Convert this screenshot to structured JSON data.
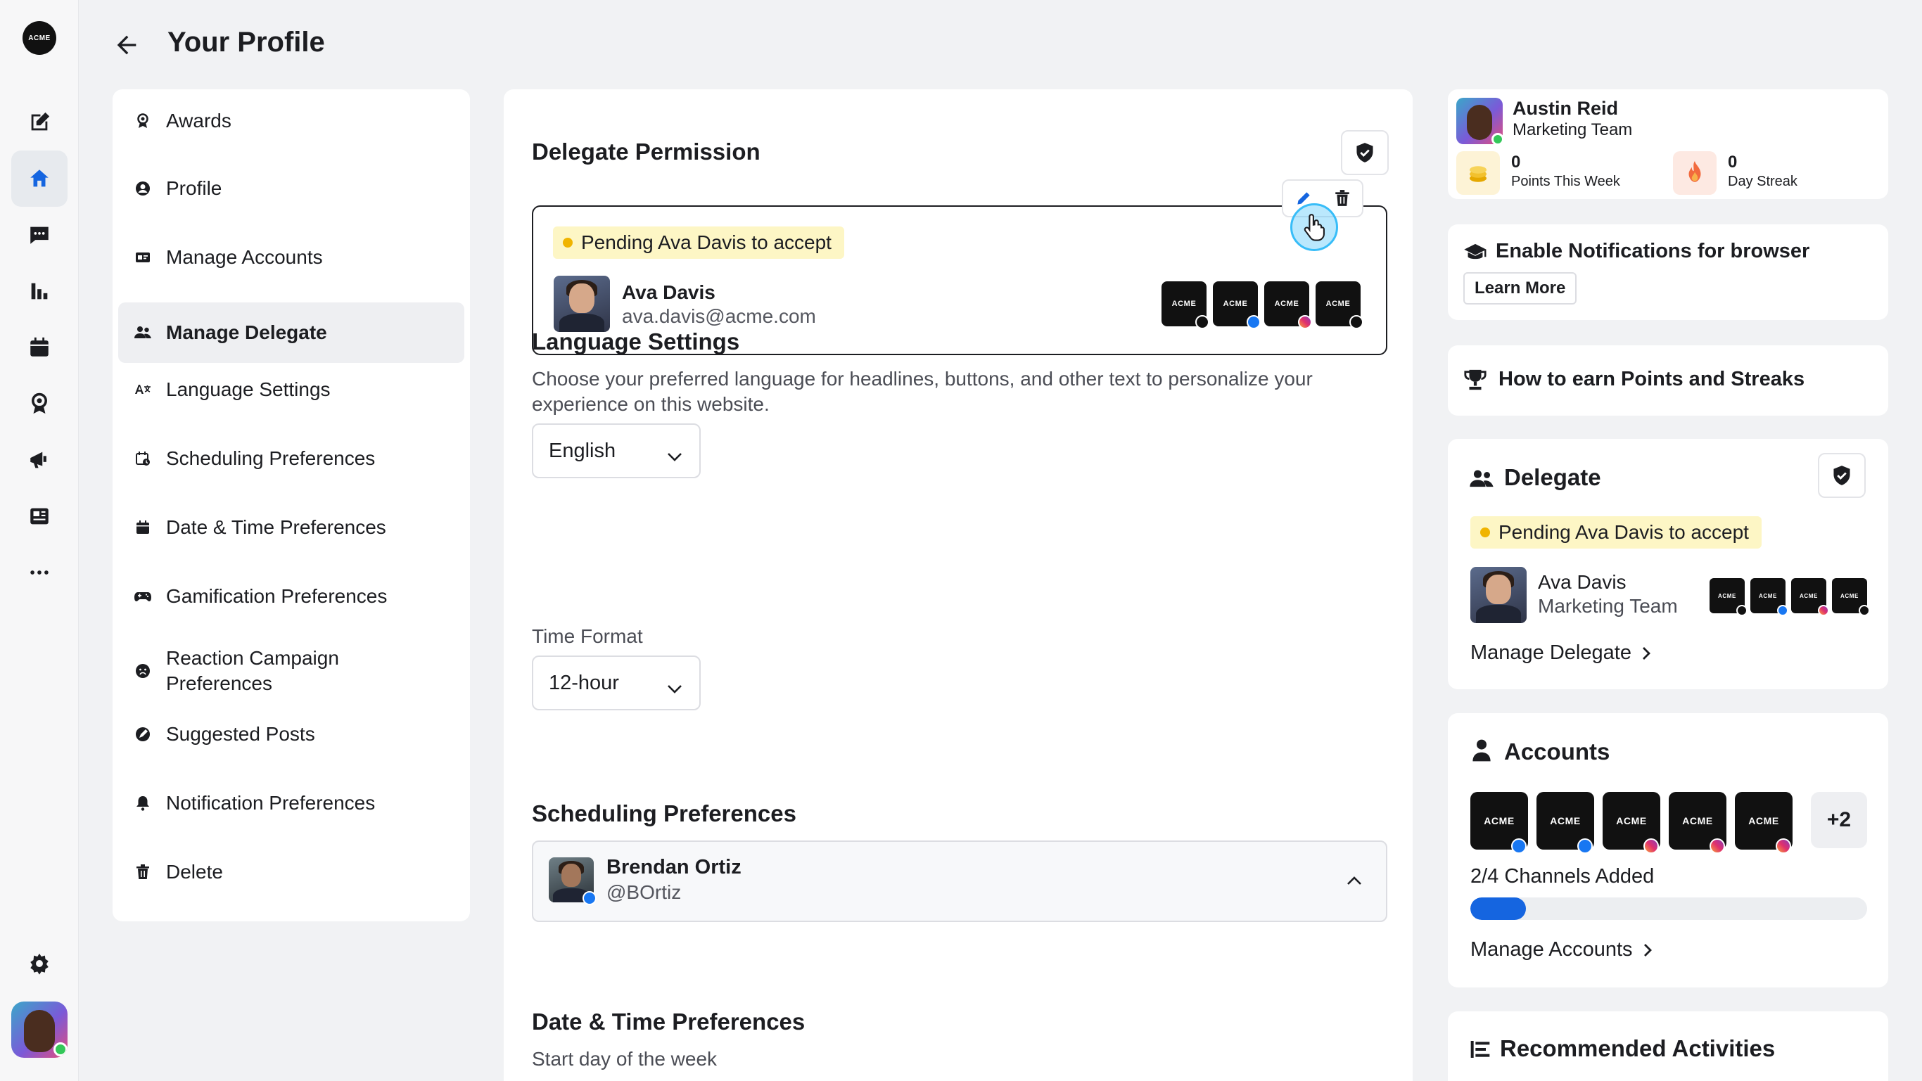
{
  "header": {
    "title": "Your Profile"
  },
  "rail": {
    "logo": "ACME",
    "icons": [
      "compose-icon",
      "home-icon",
      "chat-icon",
      "analytics-icon",
      "calendar-icon",
      "awards-icon",
      "campaign-icon",
      "news-icon",
      "more-icon",
      "settings-icon"
    ]
  },
  "nav": {
    "items": [
      {
        "label": "Awards",
        "icon": "award-icon"
      },
      {
        "label": "Profile",
        "icon": "profile-icon"
      },
      {
        "label": "Manage Accounts",
        "icon": "accounts-icon"
      },
      {
        "label": "Manage Delegate",
        "icon": "delegate-icon",
        "active": true
      },
      {
        "label": "Language Settings",
        "icon": "language-icon"
      },
      {
        "label": "Scheduling Preferences",
        "icon": "schedule-icon"
      },
      {
        "label": "Date & Time Preferences",
        "icon": "calendar-icon"
      },
      {
        "label": "Gamification Preferences",
        "icon": "gamepad-icon"
      },
      {
        "label": "Reaction Campaign Preferences",
        "icon": "reaction-icon"
      },
      {
        "label": "Suggested Posts",
        "icon": "suggest-icon"
      },
      {
        "label": "Notification Preferences",
        "icon": "bell-icon"
      },
      {
        "label": "Delete",
        "icon": "trash-icon"
      }
    ]
  },
  "delegate_permission": {
    "title": "Delegate Permission",
    "pending": "Pending Ava Davis to accept",
    "name": "Ava Davis",
    "email": "ava.davis@acme.com",
    "channels": [
      {
        "label": "ACME",
        "network": "x"
      },
      {
        "label": "ACME",
        "network": "facebook"
      },
      {
        "label": "ACME",
        "network": "instagram"
      },
      {
        "label": "ACME",
        "network": "tiktok"
      }
    ]
  },
  "language_settings": {
    "title": "Language Settings",
    "description": "Choose your preferred language for headlines, buttons, and other text to personalize your experience on this website.",
    "language_value": "English",
    "time_format_label": "Time Format",
    "time_format_value": "12-hour"
  },
  "scheduling": {
    "title": "Scheduling Preferences",
    "name": "Brendan Ortiz",
    "handle": "@BOrtiz"
  },
  "datetime": {
    "title": "Date & Time Preferences",
    "start_day_label": "Start day of the week"
  },
  "user_card": {
    "name": "Austin Reid",
    "team": "Marketing Team",
    "points_value": "0",
    "points_label": "Points This Week",
    "streak_value": "0",
    "streak_label": "Day Streak"
  },
  "notifications_card": {
    "title": "Enable Notifications for browser",
    "button": "Learn More"
  },
  "points_card": {
    "title": "How to earn Points and Streaks"
  },
  "delegate_card": {
    "title": "Delegate",
    "pending": "Pending Ava Davis to accept",
    "name": "Ava Davis",
    "team": "Marketing Team",
    "channels": [
      "ACME",
      "ACME",
      "ACME",
      "ACME"
    ],
    "link": "Manage Delegate"
  },
  "accounts_card": {
    "title": "Accounts",
    "channels": [
      {
        "label": "ACME",
        "network": "facebook"
      },
      {
        "label": "ACME",
        "network": "facebook"
      },
      {
        "label": "ACME",
        "network": "instagram"
      },
      {
        "label": "ACME",
        "network": "instagram"
      },
      {
        "label": "ACME",
        "network": "instagram"
      }
    ],
    "more": "+2",
    "channels_added": "2/4 Channels Added",
    "progress": 0.14,
    "link": "Manage Accounts"
  },
  "recommended_card": {
    "title": "Recommended Activities"
  },
  "colors": {
    "accent": "#1565e0",
    "pending_bg": "#fdf6c5",
    "pending_dot": "#f0b400",
    "online": "#34c759"
  }
}
